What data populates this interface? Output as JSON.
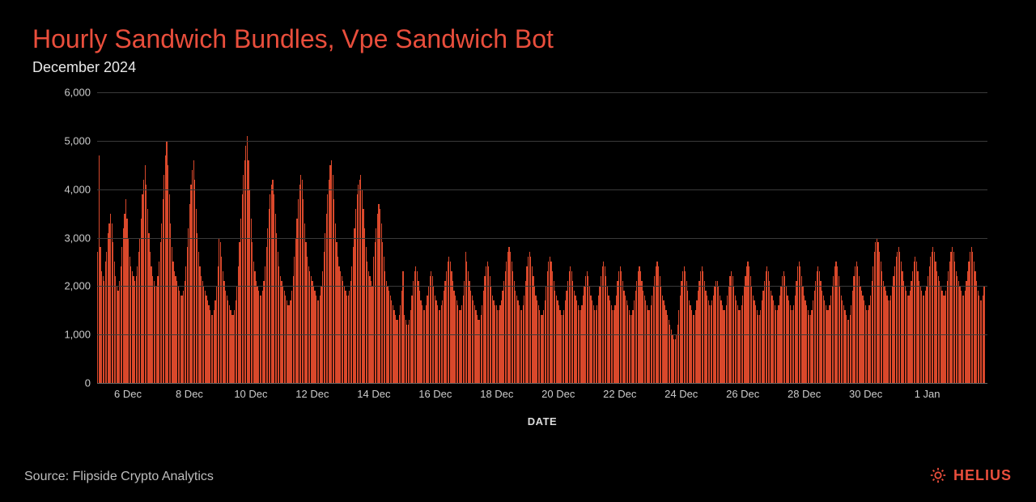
{
  "header": {
    "title": "Hourly Sandwich Bundles, Vpe Sandwich Bot",
    "subtitle": "December 2024"
  },
  "footer": {
    "source": "Source: Flipside Crypto Analytics",
    "brand": "HELIUS"
  },
  "chart_data": {
    "type": "bar",
    "title": "Hourly Sandwich Bundles, Vpe Sandwich Bot",
    "xlabel": "DATE",
    "ylabel": "",
    "ylim": [
      0,
      6000
    ],
    "yticks": [
      0,
      1000,
      2000,
      3000,
      4000,
      5000,
      6000
    ],
    "ytick_labels": [
      "0",
      "1,000",
      "2,000",
      "3,000",
      "4,000",
      "5,000",
      "6,000"
    ],
    "xticks": [
      "6 Dec",
      "8 Dec",
      "10 Dec",
      "12 Dec",
      "14 Dec",
      "16 Dec",
      "18 Dec",
      "20 Dec",
      "22 Dec",
      "24 Dec",
      "26 Dec",
      "28 Dec",
      "30 Dec",
      "1 Jan"
    ],
    "x_start": "2024-12-05T00:00",
    "x_end": "2025-01-02T23:00",
    "hours_per_tick": 48,
    "first_tick_hour_offset": 24,
    "values": [
      2700,
      4700,
      2800,
      2300,
      2200,
      2100,
      2500,
      2700,
      3100,
      3300,
      3500,
      3300,
      2900,
      2500,
      2200,
      2000,
      1900,
      2100,
      2400,
      2800,
      3200,
      3500,
      3800,
      3400,
      3000,
      2600,
      2400,
      2300,
      2200,
      2100,
      2200,
      2400,
      2700,
      3000,
      3400,
      3900,
      4200,
      4500,
      4100,
      3600,
      3100,
      2700,
      2400,
      2200,
      2100,
      2000,
      2000,
      2200,
      2500,
      2900,
      3300,
      3800,
      4300,
      4700,
      5000,
      4500,
      3900,
      3300,
      2800,
      2500,
      2300,
      2200,
      2100,
      2000,
      1900,
      1800,
      1800,
      1900,
      2100,
      2400,
      2800,
      3200,
      3700,
      4100,
      4400,
      4600,
      4200,
      3600,
      3100,
      2700,
      2400,
      2200,
      2100,
      2000,
      1900,
      1800,
      1700,
      1600,
      1500,
      1400,
      1400,
      1500,
      1700,
      2000,
      2400,
      3000,
      2900,
      2600,
      2300,
      2100,
      1900,
      1800,
      1700,
      1600,
      1500,
      1400,
      1400,
      1500,
      1700,
      2000,
      2400,
      2900,
      3400,
      3900,
      4300,
      4600,
      4900,
      5100,
      4600,
      4000,
      3400,
      2900,
      2500,
      2300,
      2100,
      2000,
      1900,
      1800,
      1800,
      1900,
      2100,
      2400,
      2800,
      3200,
      3600,
      3900,
      4100,
      4200,
      3900,
      3500,
      3100,
      2700,
      2400,
      2200,
      2100,
      2000,
      1900,
      1800,
      1700,
      1600,
      1600,
      1700,
      1900,
      2200,
      2600,
      3000,
      3400,
      3800,
      4100,
      4300,
      4200,
      3800,
      3300,
      2900,
      2600,
      2400,
      2300,
      2200,
      2100,
      2000,
      1900,
      1800,
      1700,
      1700,
      1800,
      2000,
      2300,
      2700,
      3100,
      3500,
      3900,
      4200,
      4500,
      4600,
      4300,
      3800,
      3300,
      2900,
      2600,
      2400,
      2300,
      2200,
      2100,
      2000,
      1900,
      1800,
      1800,
      1900,
      2100,
      2400,
      2800,
      3200,
      3600,
      3900,
      4100,
      4200,
      4300,
      4000,
      3600,
      3200,
      2800,
      2500,
      2300,
      2200,
      2100,
      2000,
      2600,
      2900,
      3200,
      3500,
      3700,
      3600,
      3300,
      2900,
      2600,
      2300,
      2100,
      2000,
      1900,
      1800,
      1700,
      1600,
      1500,
      1400,
      1300,
      1300,
      1400,
      1600,
      1900,
      2300,
      1400,
      1300,
      1200,
      1200,
      1300,
      1500,
      1800,
      2100,
      2300,
      2400,
      2300,
      2100,
      1900,
      1700,
      1600,
      1500,
      1500,
      1600,
      1800,
      2000,
      2200,
      2300,
      2200,
      2000,
      1800,
      1700,
      1600,
      1500,
      1500,
      1600,
      1700,
      1900,
      2100,
      2300,
      2500,
      2600,
      2500,
      2300,
      2100,
      1900,
      1800,
      1700,
      1600,
      1500,
      1500,
      1600,
      1800,
      2100,
      2700,
      2500,
      2300,
      2100,
      1900,
      1800,
      1700,
      1600,
      1500,
      1400,
      1300,
      1300,
      1400,
      1600,
      1900,
      2200,
      2400,
      2500,
      2400,
      2200,
      2000,
      1800,
      1700,
      1600,
      1600,
      1500,
      1500,
      1600,
      1700,
      1900,
      2100,
      2300,
      2500,
      2700,
      2800,
      2700,
      2500,
      2300,
      2100,
      1900,
      1800,
      1700,
      1600,
      1500,
      1500,
      1600,
      1800,
      2100,
      2400,
      2600,
      2700,
      2600,
      2400,
      2200,
      2000,
      1800,
      1700,
      1600,
      1500,
      1400,
      1400,
      1500,
      1700,
      2000,
      2300,
      2500,
      2600,
      2500,
      2300,
      2100,
      1900,
      1800,
      1700,
      1600,
      1500,
      1400,
      1400,
      1500,
      1700,
      1900,
      2100,
      2300,
      2400,
      2300,
      2100,
      1900,
      1800,
      1700,
      1600,
      1500,
      1500,
      1600,
      1800,
      2000,
      2200,
      2300,
      2200,
      2000,
      1800,
      1700,
      1600,
      1500,
      1500,
      1600,
      1800,
      2000,
      2200,
      2400,
      2500,
      2400,
      2200,
      2000,
      1800,
      1700,
      1600,
      1500,
      1500,
      1600,
      1800,
      2100,
      2300,
      2400,
      2300,
      2100,
      1900,
      1800,
      1700,
      1600,
      1500,
      1400,
      1400,
      1500,
      1700,
      1900,
      2100,
      2300,
      2400,
      2300,
      2100,
      1900,
      1800,
      1700,
      1600,
      1500,
      1500,
      1600,
      1800,
      2000,
      2200,
      2400,
      2500,
      2400,
      2200,
      2000,
      1800,
      1700,
      1600,
      1500,
      1400,
      1300,
      1200,
      1100,
      1000,
      900,
      900,
      1000,
      1200,
      1500,
      1800,
      2100,
      2300,
      2400,
      2300,
      2100,
      1900,
      1700,
      1600,
      1500,
      1400,
      1400,
      1500,
      1700,
      1900,
      2100,
      2300,
      2400,
      2300,
      2100,
      1900,
      1800,
      1700,
      1600,
      1600,
      1700,
      1800,
      2000,
      2100,
      2100,
      2000,
      1800,
      1700,
      1600,
      1500,
      1500,
      1600,
      1800,
      2000,
      2200,
      2300,
      2200,
      2000,
      1800,
      1700,
      1600,
      1500,
      1500,
      1600,
      1800,
      2000,
      2200,
      2400,
      2500,
      2400,
      2200,
      2000,
      1800,
      1700,
      1600,
      1500,
      1400,
      1400,
      1500,
      1700,
      1900,
      2100,
      2300,
      2400,
      2300,
      2100,
      1900,
      1800,
      1700,
      1600,
      1500,
      1500,
      1600,
      1800,
      2000,
      2200,
      2300,
      2200,
      2000,
      1800,
      1700,
      1600,
      1500,
      1500,
      1600,
      1800,
      2100,
      2400,
      2500,
      2400,
      2200,
      2000,
      1800,
      1700,
      1600,
      1500,
      1400,
      1400,
      1500,
      1700,
      1900,
      2100,
      2300,
      2400,
      2300,
      2100,
      1900,
      1800,
      1700,
      1600,
      1500,
      1500,
      1600,
      1800,
      2000,
      2200,
      2400,
      2500,
      2400,
      2200,
      2000,
      1800,
      1700,
      1600,
      1500,
      1400,
      1300,
      1300,
      1400,
      1600,
      1900,
      2200,
      2400,
      2500,
      2400,
      2200,
      2000,
      1900,
      1800,
      1700,
      1600,
      1500,
      1500,
      1600,
      1800,
      2100,
      2400,
      2700,
      2900,
      3000,
      2900,
      2700,
      2500,
      2300,
      2100,
      2000,
      1900,
      1800,
      1700,
      1700,
      1800,
      2000,
      2200,
      2400,
      2600,
      2700,
      2800,
      2700,
      2500,
      2300,
      2100,
      2000,
      1900,
      1800,
      1800,
      1900,
      2100,
      2300,
      2500,
      2600,
      2500,
      2300,
      2100,
      2000,
      1900,
      1800,
      1800,
      1900,
      2000,
      2200,
      2400,
      2600,
      2700,
      2800,
      2700,
      2500,
      2300,
      2200,
      2100,
      2000,
      1900,
      1800,
      1800,
      1900,
      2100,
      2300,
      2500,
      2700,
      2800,
      2700,
      2500,
      2300,
      2200,
      2100,
      2000,
      1900,
      1800,
      1800,
      1900,
      2100,
      2300,
      2500,
      2700,
      2800,
      2700,
      2500,
      2300,
      2100,
      1900,
      1800,
      1700,
      1700,
      1800,
      2000
    ]
  }
}
